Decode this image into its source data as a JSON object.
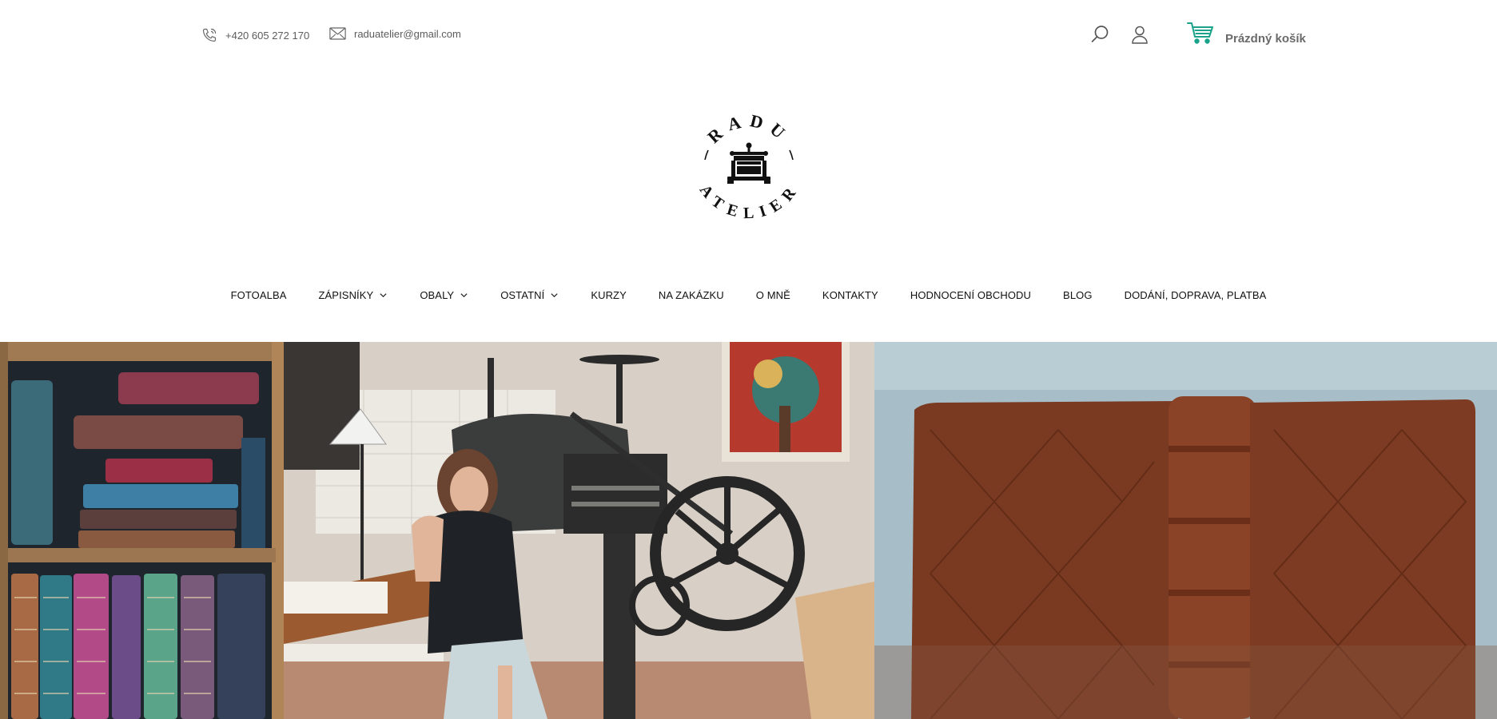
{
  "header": {
    "phone": "+420 605 272 170",
    "email": "raduatelier@gmail.com",
    "cart_label": "Prázdný košík",
    "icons": {
      "phone": "phone-icon",
      "email": "envelope-icon",
      "search": "search-icon",
      "account": "user-icon",
      "cart": "cart-icon"
    },
    "cart_icon_color": "#1aa38a"
  },
  "logo": {
    "arc_top": "RADU",
    "arc_bottom": "ATELIER",
    "emblem": "book-press-icon"
  },
  "nav": {
    "items": [
      {
        "label": "FOTOALBA",
        "dropdown": false
      },
      {
        "label": "ZÁPISNÍKY",
        "dropdown": true
      },
      {
        "label": "OBALY",
        "dropdown": true
      },
      {
        "label": "OSTATNÍ",
        "dropdown": true
      },
      {
        "label": "KURZY",
        "dropdown": false
      },
      {
        "label": "NA ZAKÁZKU",
        "dropdown": false
      },
      {
        "label": "O MNĚ",
        "dropdown": false
      },
      {
        "label": "KONTAKTY",
        "dropdown": false
      },
      {
        "label": "HODNOCENÍ OBCHODU",
        "dropdown": false
      },
      {
        "label": "BLOG",
        "dropdown": false
      },
      {
        "label": "DODÁNÍ, DOPRAVA, PLATBA",
        "dropdown": false
      }
    ]
  },
  "hero": {
    "panels": [
      "bookshelf-photo",
      "atelier-press-photo",
      "leather-album-photo"
    ]
  }
}
